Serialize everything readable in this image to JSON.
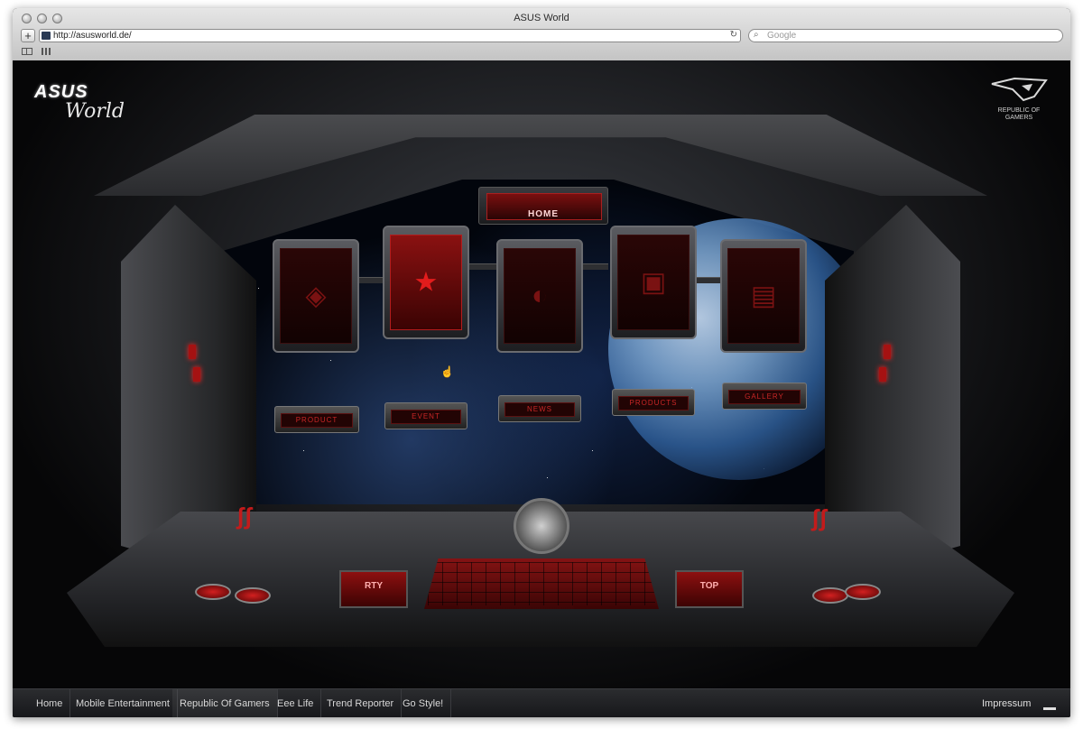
{
  "browser": {
    "window_title": "ASUS World",
    "url": "http://asusworld.de/",
    "search_placeholder": "Google"
  },
  "site": {
    "logo_brand": "ASUS",
    "logo_tagline": "World",
    "rog_label": "REPUBLIC OF GAMERS",
    "home_label": "HOME",
    "sub_buttons": [
      "PRODUCT",
      "EVENT",
      "NEWS",
      "PRODUCTS",
      "GALLERY"
    ],
    "left_screen_text": "RTY",
    "right_screen_text": "TOP"
  },
  "nav": {
    "items": [
      "Home",
      "Mobile Entertainment",
      "Republic Of Gamers",
      "Eee Life",
      "Trend Reporter",
      "Go Style!"
    ],
    "active_index": 2,
    "impressum": "Impressum"
  }
}
